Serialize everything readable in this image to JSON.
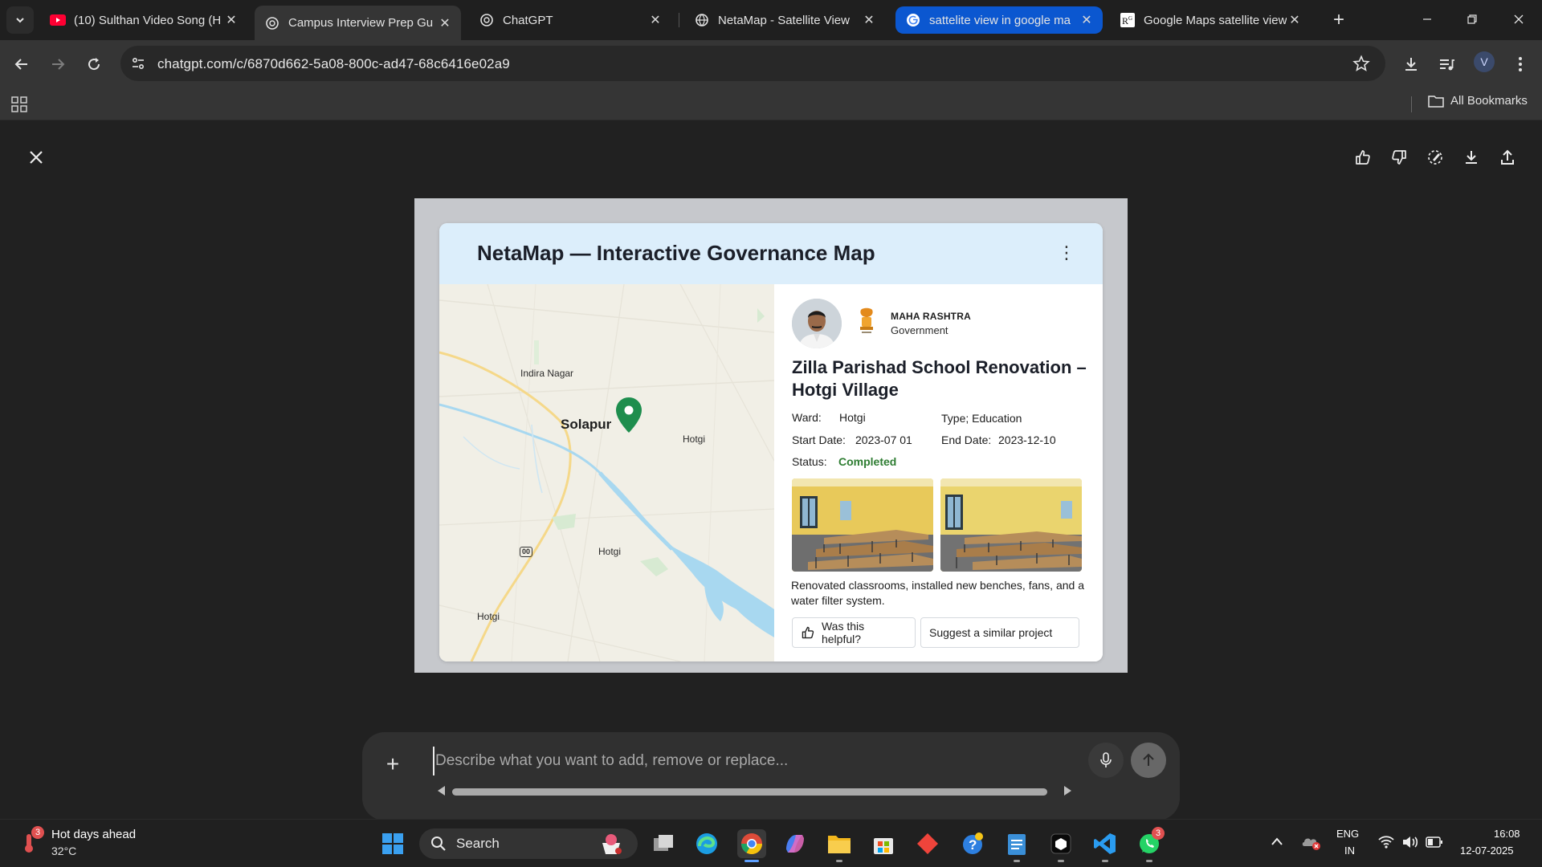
{
  "browser": {
    "tabs": [
      {
        "title": "(10) Sulthan Video Song (H",
        "icon": "youtube-icon"
      },
      {
        "title": "Campus Interview Prep Gu",
        "icon": "chatgpt-icon"
      },
      {
        "title": "ChatGPT",
        "icon": "chatgpt-icon"
      },
      {
        "title": "NetaMap - Satellite View",
        "icon": "globe-icon"
      },
      {
        "title": "sattelite view in google ma",
        "icon": "google-icon"
      },
      {
        "title": "Google Maps satellite view",
        "icon": "rg-icon"
      }
    ],
    "url": "chatgpt.com/c/6870d662-5a08-800c-ad47-68c6416e02a9",
    "avatar_initial": "V",
    "bookmarks_label": "All Bookmarks"
  },
  "card": {
    "title": "NetaMap — Interactive Governance Map",
    "map_labels": {
      "indira_nagar": "Indira Nagar",
      "solapur": "Solapur",
      "hotgi_1": "Hotgi",
      "hotgi_2": "Hotgi",
      "hotgi_3": "Hotgi",
      "highway": "00"
    },
    "gov_state": "MAHA RASHTRA",
    "gov_sub": "Government",
    "project_title": "Zilla Parishad School Renovation – Hotgi Village",
    "ward_label": "Ward:",
    "ward_value": "Hotgi",
    "type_text": "Type; Education",
    "start_label": "Start Date:",
    "start_value": "2023-07 01",
    "end_label": "End Date:",
    "end_value": "2023-12-10",
    "status_label": "Status:",
    "status_value": "Completed",
    "description": "Renovated classrooms, installed new benches, fans, and a water filter system.",
    "helpful_label": "Was this helpful?",
    "suggest_label": "Suggest a similar project"
  },
  "composer": {
    "placeholder": "Describe what you want to add, remove or replace..."
  },
  "taskbar": {
    "weather_title": "Hot days ahead",
    "weather_temp": "32°C",
    "weather_badge": "3",
    "search_label": "Search",
    "whatsapp_badge": "3",
    "lang_1": "ENG",
    "lang_2": "IN",
    "time": "16:08",
    "date": "12-07-2025"
  },
  "colors": {
    "chrome_dark": "#1f1f1f",
    "toolbar": "#353535",
    "page_bg": "#212121",
    "card_header": "#dceefb",
    "status_green": "#2e7d32",
    "map_pin": "#1e8e4e",
    "water": "#a8d8f0"
  }
}
